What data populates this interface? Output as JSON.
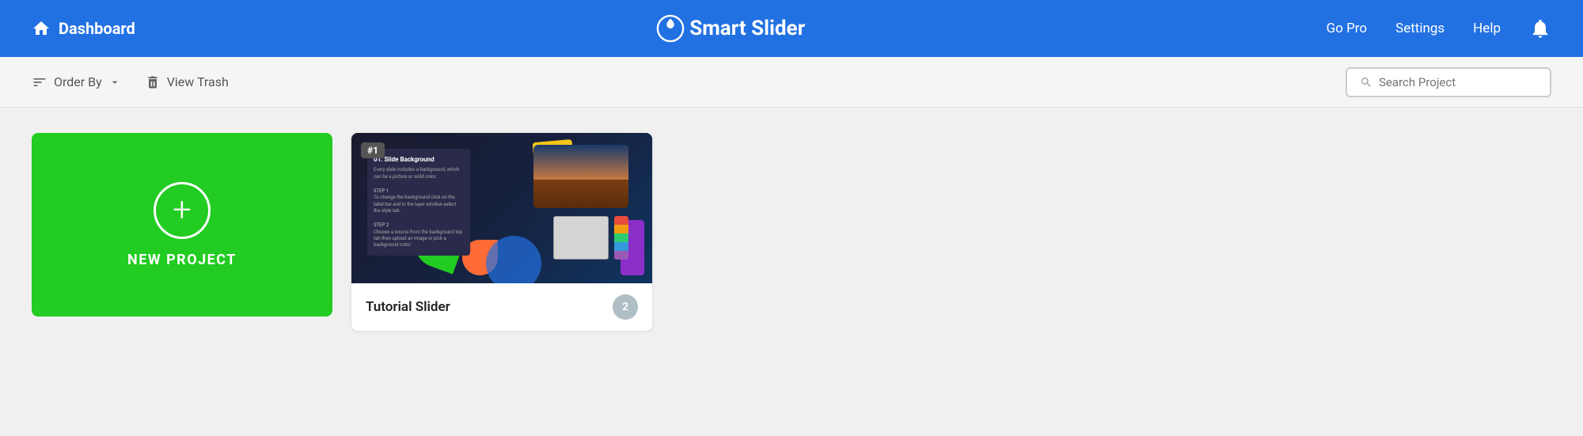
{
  "header": {
    "dashboard_label": "Dashboard",
    "logo_text": "Smart Slider",
    "nav": {
      "go_pro": "Go Pro",
      "settings": "Settings",
      "help": "Help"
    }
  },
  "toolbar": {
    "order_by_label": "Order By",
    "view_trash_label": "View Trash",
    "search_placeholder": "Search Project"
  },
  "content": {
    "new_project_label": "NEW PROJECT",
    "slider_card": {
      "title": "Tutorial Slider",
      "slide_count": "2",
      "badge": "#1"
    }
  },
  "colors": {
    "header_bg": "#2271e3",
    "new_project_bg": "#22cc22",
    "body_bg": "#f0f0f0"
  }
}
